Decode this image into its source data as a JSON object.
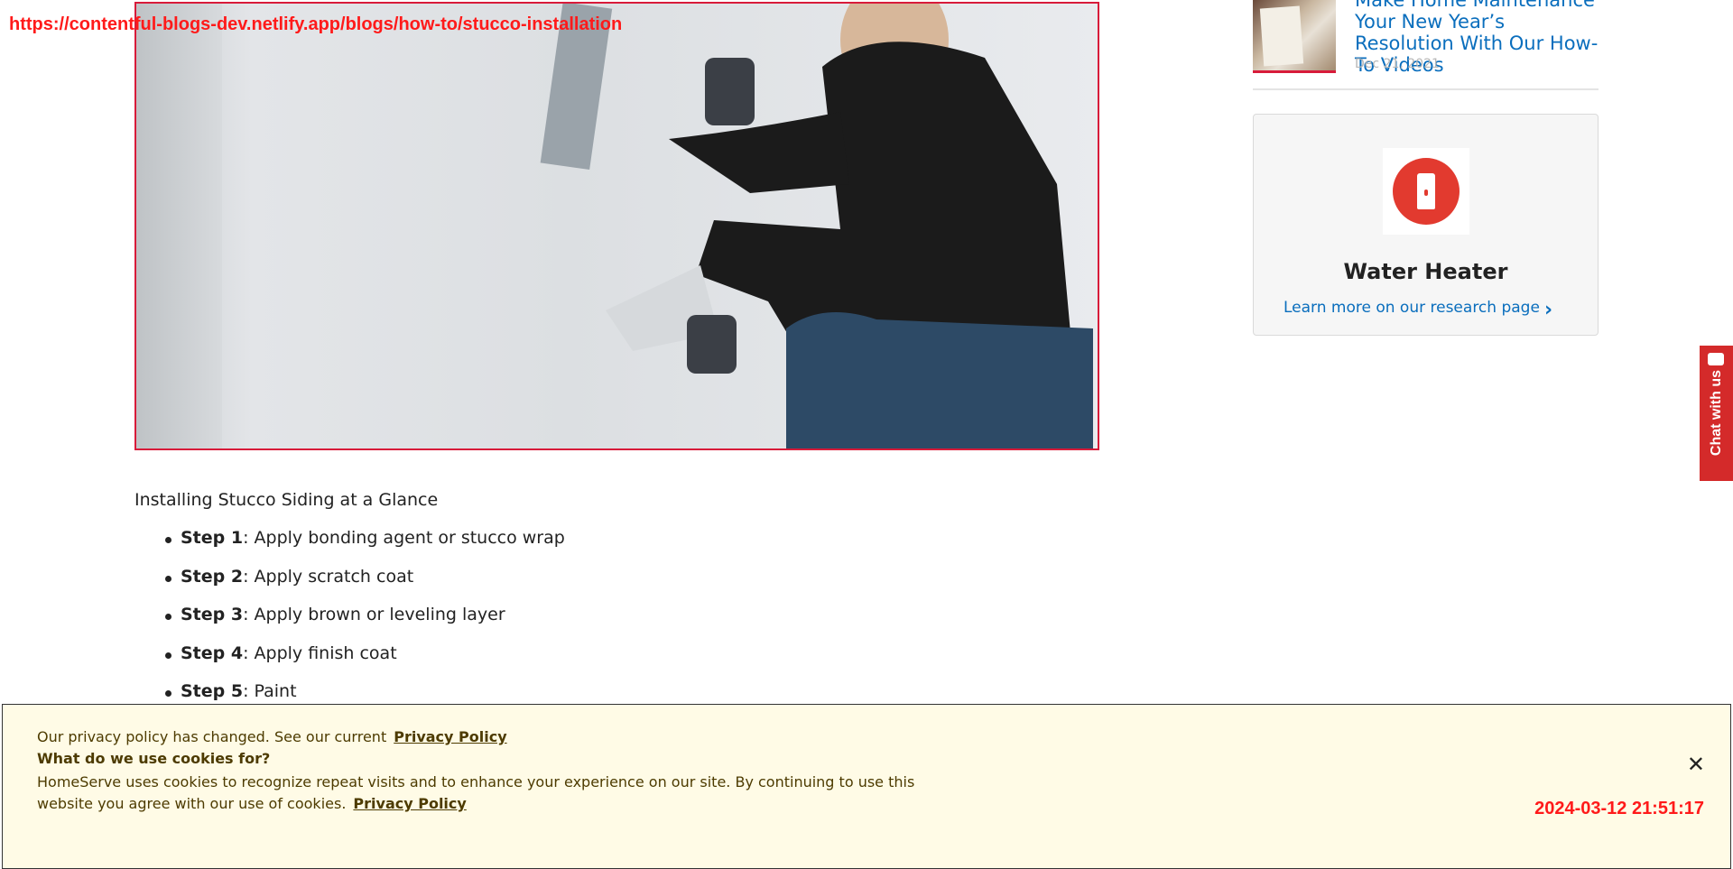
{
  "overlay": {
    "url": "https://contentful-blogs-dev.netlify.app/blogs/how-to/stucco-installation",
    "timestamp": "2024-03-12 21:51:17"
  },
  "article": {
    "hero_alt": "Worker applying stucco to a wall",
    "glance_heading": "Installing Stucco Siding at a Glance",
    "steps": [
      {
        "label": "Step 1",
        "text": ": Apply bonding agent or stucco wrap"
      },
      {
        "label": "Step 2",
        "text": ": Apply scratch coat"
      },
      {
        "label": "Step 3",
        "text": ": Apply brown or leveling layer"
      },
      {
        "label": "Step 4",
        "text": ": Apply finish coat"
      },
      {
        "label": "Step 5",
        "text": ": Paint"
      }
    ]
  },
  "sidebar": {
    "post": {
      "title": "Make Home Maintenance Your New Year’s Resolution With Our How-To Videos",
      "date": "Dec 21, 2021"
    },
    "card": {
      "title": "Water Heater",
      "link": "Learn more on our research page"
    }
  },
  "chat": {
    "label": "Chat with us"
  },
  "cookie": {
    "line1": "Our privacy policy has changed. See our current",
    "policy_link": "Privacy Policy",
    "question": "What do we use cookies for?",
    "body": "HomeServe uses cookies to recognize repeat visits and to enhance your experience on our site. By continuing to use this website you agree with our use of cookies.",
    "close": "✕"
  }
}
